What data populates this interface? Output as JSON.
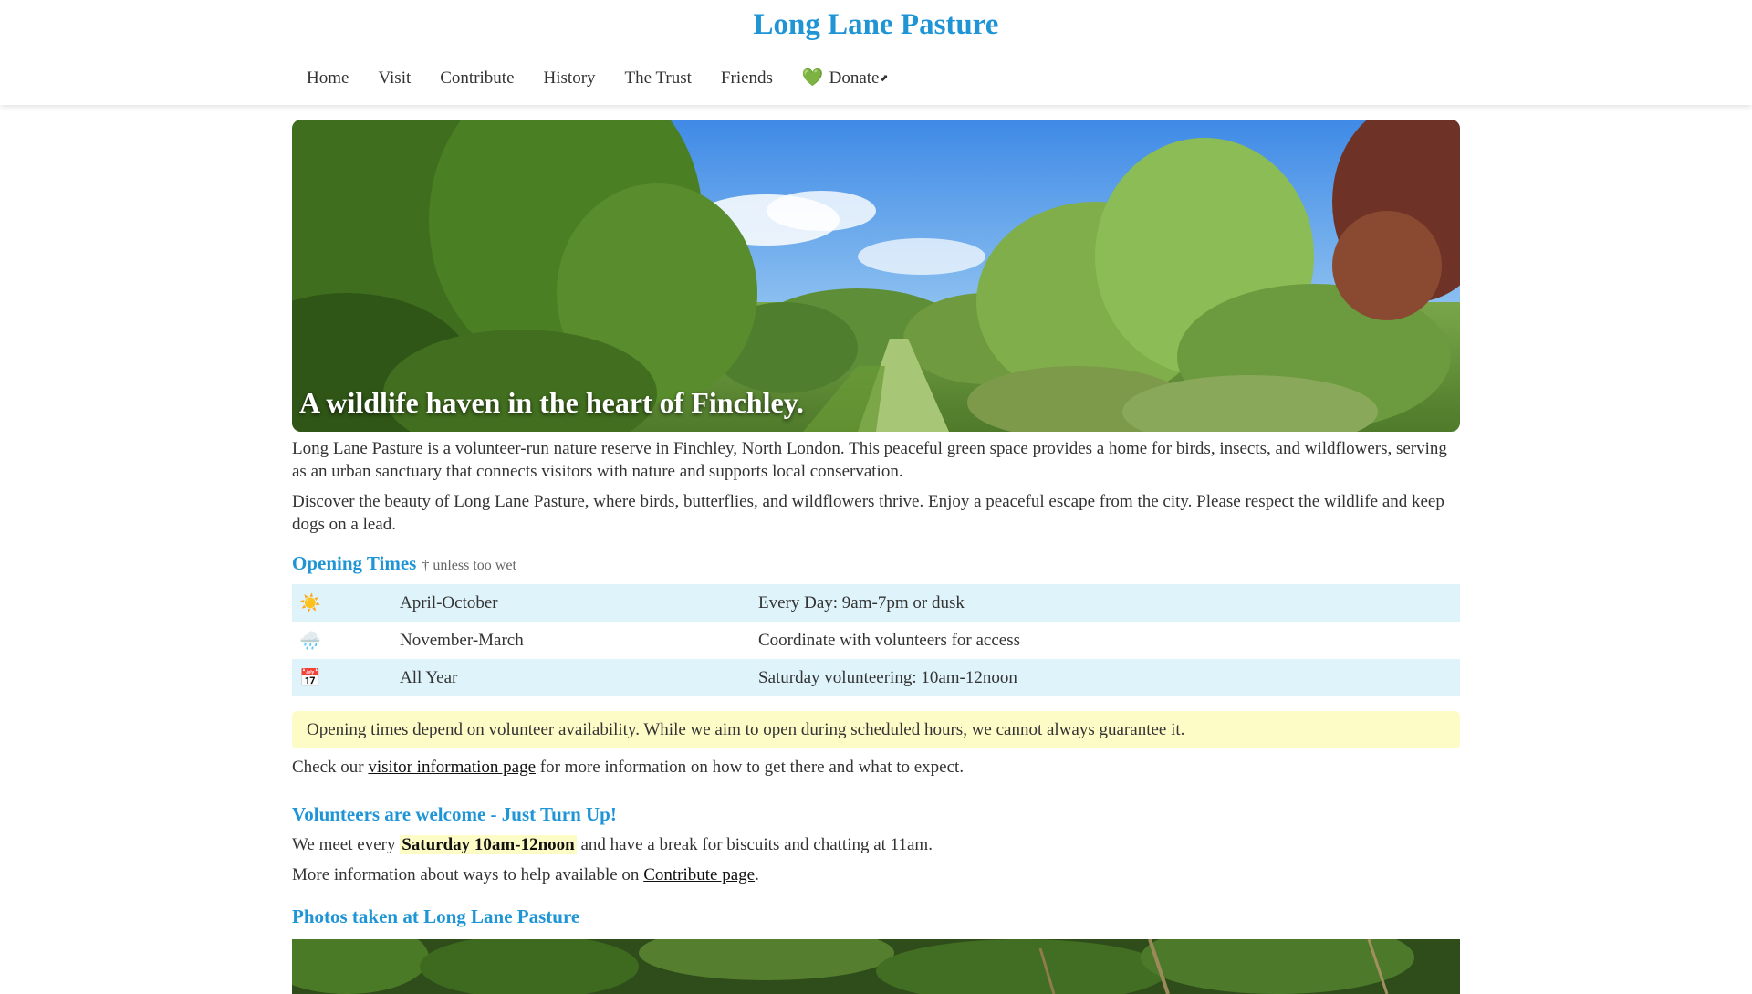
{
  "site": {
    "title": "Long Lane Pasture",
    "brand_color": "#1f95d6"
  },
  "nav": {
    "items": [
      "Home",
      "Visit",
      "Contribute",
      "History",
      "The Trust",
      "Friends"
    ],
    "donate_icon": "💚",
    "donate_label": "Donate",
    "donate_ext_icon": "⬈"
  },
  "hero": {
    "caption": "A wildlife haven in the heart of Finchley."
  },
  "intro": {
    "p1": "Long Lane Pasture is a volunteer-run nature reserve in Finchley, North London. This peaceful green space provides a home for birds, insects, and wildflowers, serving as an urban sanctuary that connects visitors with nature and supports local conservation.",
    "p2": "Discover the beauty of Long Lane Pasture, where birds, butterflies, and wildflowers thrive. Enjoy a peaceful escape from the city. Please respect the wildlife and keep dogs on a lead."
  },
  "opening": {
    "heading": "Opening Times",
    "note": "† unless too wet",
    "rows": [
      {
        "icon": "☀️",
        "icon_name": "sun-icon",
        "period": "April-October",
        "detail": "Every Day: 9am-7pm or dusk"
      },
      {
        "icon": "🌧️",
        "icon_name": "rain-cloud-icon",
        "period": "November-March",
        "detail": "Coordinate with volunteers for access"
      },
      {
        "icon": "📅",
        "icon_name": "calendar-icon",
        "period": "All Year",
        "detail": "Saturday volunteering: 10am-12noon"
      }
    ],
    "warning": "Opening times depend on volunteer availability. While we aim to open during scheduled hours, we cannot always guarantee it.",
    "check_before": "Check our ",
    "check_link": "visitor information page",
    "check_after": " for more information on how to get there and what to expect."
  },
  "volunteers": {
    "heading": "Volunteers are welcome - Just Turn Up!",
    "meet_before": "We meet every ",
    "meet_highlight": "Saturday 10am-12noon",
    "meet_after": " and have a break for biscuits and chatting at 11am.",
    "more_before": "More information about ways to help available on ",
    "more_link": "Contribute page",
    "more_after": "."
  },
  "photos": {
    "heading": "Photos taken at Long Lane Pasture"
  }
}
